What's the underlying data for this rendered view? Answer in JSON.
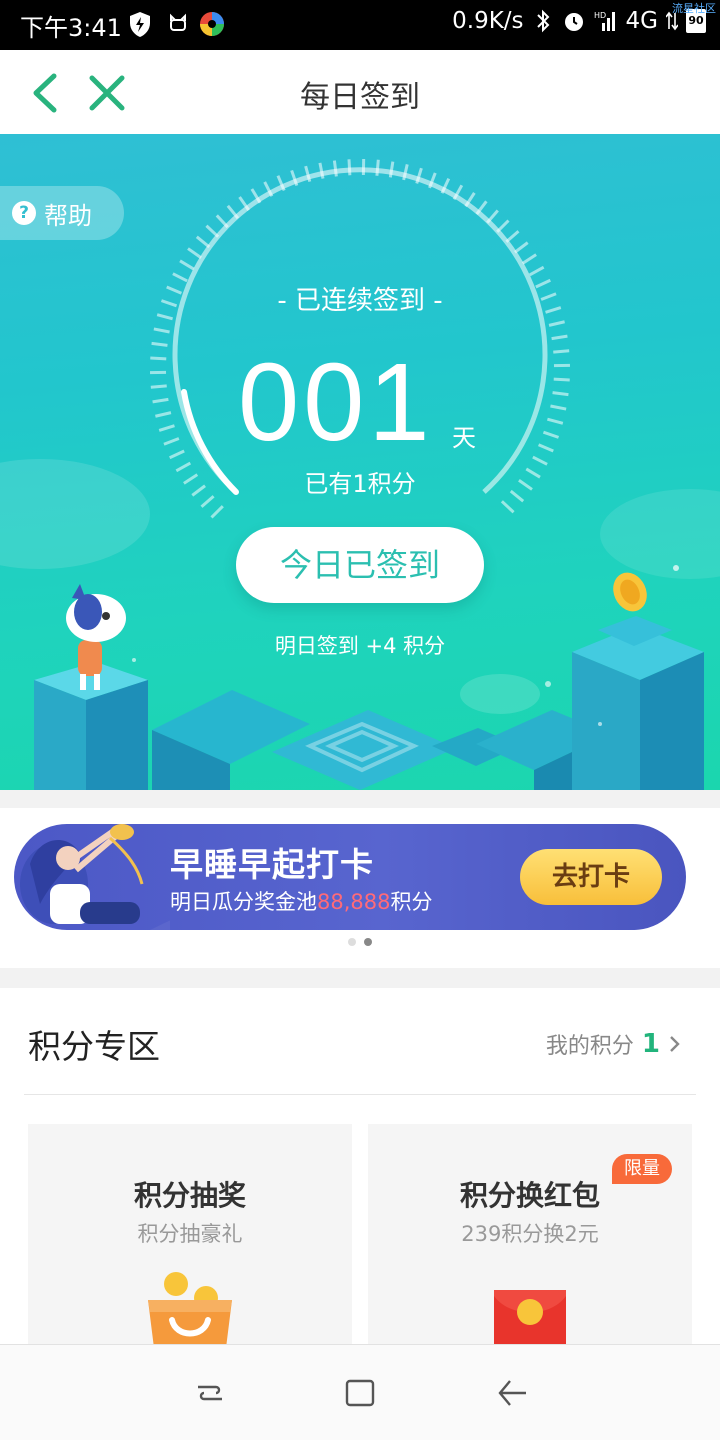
{
  "status_bar": {
    "time": "下午3:41",
    "speed": "0.9K/s",
    "network": "4G",
    "battery": "90",
    "corner_text": "流星社区"
  },
  "header": {
    "title": "每日签到"
  },
  "hero": {
    "help_label": "帮助",
    "streak_label": "- 已连续签到 -",
    "streak_days": "001",
    "streak_unit": "天",
    "points_have": "已有1积分",
    "signed_button": "今日已签到",
    "tomorrow_text": "明日签到 +4 积分",
    "colors": {
      "gradient_top": "#2fbfd4",
      "gradient_bottom": "#1bd6ae",
      "button_text": "#2bbfb0"
    }
  },
  "banner": {
    "title": "早睡早起打卡",
    "subtitle_prefix": "明日瓜分奖金池",
    "subtitle_amount": "88,888",
    "subtitle_suffix": "积分",
    "button_label": "去打卡",
    "dots": {
      "count": 2,
      "active_index": 1
    }
  },
  "points_zone": {
    "title": "积分专区",
    "my_points_label": "我的积分",
    "my_points_value": "1",
    "cards": [
      {
        "title": "积分抽奖",
        "subtitle": "积分抽豪礼",
        "icon": "gift-bag-icon"
      },
      {
        "title": "积分换红包",
        "subtitle": "239积分换2元",
        "badge": "限量",
        "icon": "red-envelope-icon"
      }
    ],
    "colors": {
      "accent": "#22b47c",
      "badge": "#f86a3a"
    }
  }
}
